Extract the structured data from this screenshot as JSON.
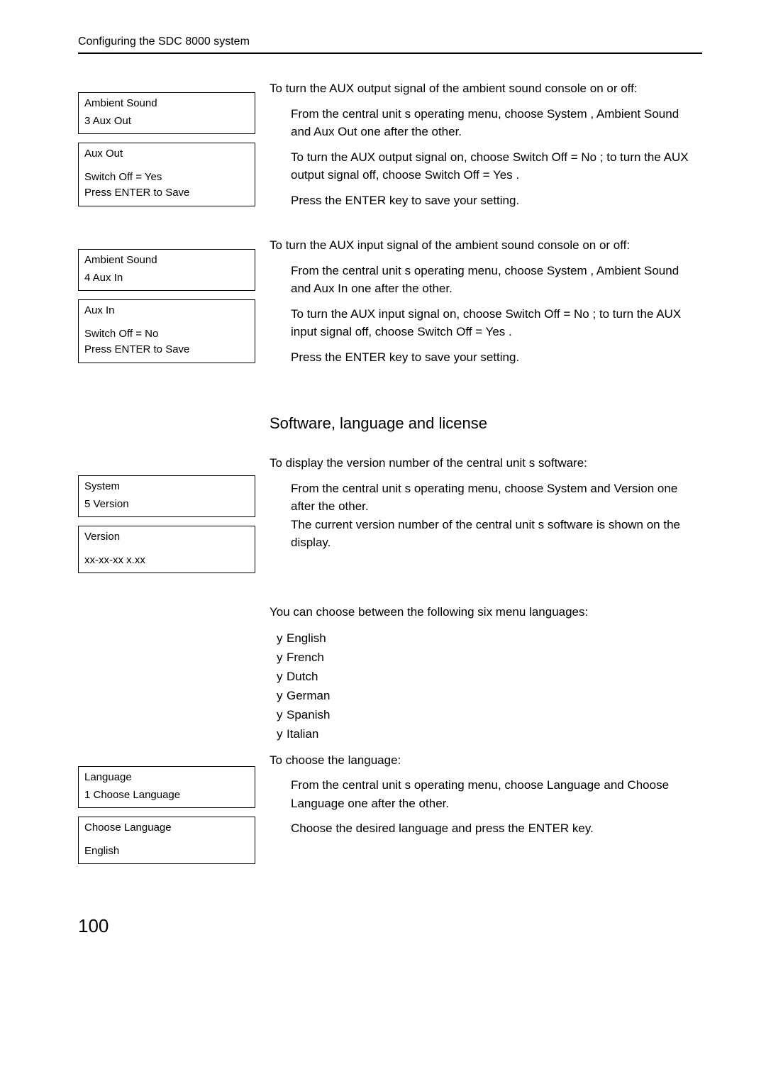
{
  "header": "Configuring the SDC 8000 system",
  "pageNumber": "100",
  "lcd": {
    "ambOut1": {
      "l1": "Ambient Sound",
      "l2": "3   Aux Out"
    },
    "ambOut2": {
      "l1": "Aux Out",
      "l2": "Switch Off = Yes",
      "l3": "Press ENTER to Save"
    },
    "ambIn1": {
      "l1": "Ambient Sound",
      "l2": "4   Aux In"
    },
    "ambIn2": {
      "l1": "Aux In",
      "l2": "Switch Off = No",
      "l3": "Press ENTER to Save"
    },
    "sys1": {
      "l1": "System",
      "l2": "5   Version"
    },
    "sys2": {
      "l1": "Version",
      "l2": "xx-xx-xx x.xx"
    },
    "lang1": {
      "l1": "Language",
      "l2": "1   Choose Language"
    },
    "lang2": {
      "l1": "Choose Language",
      "l2": "English"
    }
  },
  "text": {
    "auxOutTitle": "To turn the AUX output signal of the  ambient sound  console on or off:",
    "auxOutS1a": "From the central unit s operating menu, choose",
    "auxOutS1b": "System",
    "auxOutS1c": ",   Ambient Sound",
    "auxOutS1d": "  and  ",
    "auxOutS1e": "Aux Out",
    "auxOutS1f": "   one after the other.",
    "auxOutS2a": "To turn the AUX output signal on, choose",
    "auxOutS2b": "Switch Off = No",
    "auxOutS2c": "      ; to turn the AUX output signal off, choose ",
    "auxOutS2d": "Switch Off = Yes",
    "auxOutS2e": "     .",
    "auxOutS3": "Press the ENTER key to save your setting.",
    "auxInTitle": "To turn the AUX input signal of the  ambient sound  console on or off:",
    "auxInS1a": "From the central unit s operating menu, choose",
    "auxInS1b": "System",
    "auxInS1c": ",   Ambient Sound",
    "auxInS1d": "  and  ",
    "auxInS1e": "Aux In",
    "auxInS1f": "   one after the other.",
    "auxInS2a": "To turn the AUX input signal on, choose",
    "auxInS2b": "Switch Off = No",
    "auxInS2c": "      ; to turn the AUX input signal off, choose ",
    "auxInS2d": "Switch Off = Yes",
    "auxInS2e": "     .",
    "auxInS3": "Press the ENTER key to save your setting.",
    "sectionTitle": "Software, language and license",
    "verTitle": "To display the version number of the central unit s software:",
    "verS1a": "From  the  central  unit s  operating  menu,  choose ",
    "verS1b": "System",
    "verS1c": "   and  ",
    "verS1d": "Version",
    "verS1e": "   one after the other.",
    "verS1f": "The current version number of the central unit s software is shown on the display.",
    "langIntro": "You can choose between the following six menu languages:",
    "langs": [
      "English",
      "French",
      "Dutch",
      "German",
      "Spanish",
      "Italian"
    ],
    "langChoose": "To choose the language:",
    "langS1a": "From  the  central  unit s  operating  menu,  choose",
    "langS1b": "Language",
    "langS1c": "   and  ",
    "langS1d": "Choose Language",
    "langS1e": "   one after the other.",
    "langS2": "Choose the desired language and press the ENTER key."
  }
}
